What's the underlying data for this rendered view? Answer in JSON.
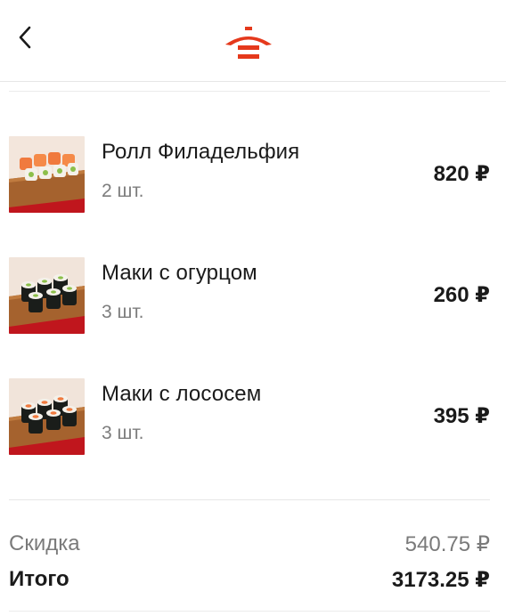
{
  "header": {
    "back_icon": "chevron-left-icon",
    "logo_icon": "restaurant-logo-icon",
    "brand_color": "#e5391c"
  },
  "order": {
    "items": [
      {
        "name": "Ролл Филадельфия",
        "qty": "2 шт.",
        "price": "820 ₽",
        "image": "philadelphia-roll-image"
      },
      {
        "name": "Маки с огурцом",
        "qty": "3 шт.",
        "price": "260 ₽",
        "image": "maki-cucumber-image"
      },
      {
        "name": "Маки с лососем",
        "qty": "3 шт.",
        "price": "395 ₽",
        "image": "maki-salmon-image"
      }
    ]
  },
  "summary": {
    "discount_label": "Скидка",
    "discount_value": "540.75 ₽",
    "total_label": "Итого",
    "total_value": "3173.25 ₽"
  }
}
